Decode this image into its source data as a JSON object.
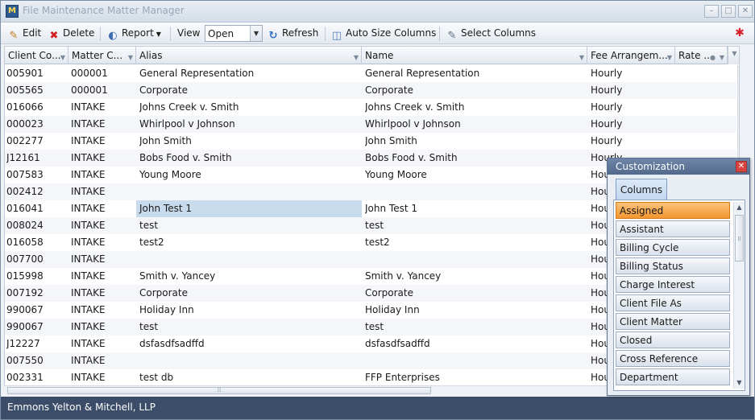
{
  "window": {
    "title": "File Maintenance Matter Manager",
    "minimize_icon": "minimize-icon",
    "maximize_icon": "maximize-icon",
    "close_icon": "close-icon"
  },
  "toolbar": {
    "edit_label": "Edit",
    "delete_label": "Delete",
    "report_label": "Report",
    "view_label": "View",
    "view_value": "Open",
    "refresh_label": "Refresh",
    "autosize_label": "Auto Size Columns",
    "select_columns_label": "Select Columns"
  },
  "grid": {
    "columns": [
      {
        "label": "Client Co..."
      },
      {
        "label": "Matter C..."
      },
      {
        "label": "Alias"
      },
      {
        "label": "Name"
      },
      {
        "label": "Fee Arrangem..."
      },
      {
        "label": "Rate ..."
      }
    ],
    "rows": [
      [
        "005901",
        "000001",
        "General Representation",
        "General Representation",
        "Hourly"
      ],
      [
        "005565",
        "000001",
        "Corporate",
        "Corporate",
        "Hourly"
      ],
      [
        "016066",
        "INTAKE",
        "Johns Creek v. Smith",
        "Johns Creek v. Smith",
        "Hourly"
      ],
      [
        "000023",
        "INTAKE",
        "Whirlpool v Johnson",
        "Whirlpool v Johnson",
        "Hourly"
      ],
      [
        "002277",
        "INTAKE",
        "John Smith",
        "John Smith",
        "Hourly"
      ],
      [
        "J12161",
        "INTAKE",
        "Bobs Food v. Smith",
        "Bobs Food v. Smith",
        "Hourly"
      ],
      [
        "007583",
        "INTAKE",
        "Young Moore",
        "Young Moore",
        "Hou"
      ],
      [
        "002412",
        "INTAKE",
        "",
        "",
        "Hou"
      ],
      [
        "016041",
        "INTAKE",
        "John Test 1",
        "John Test 1",
        "Hou"
      ],
      [
        "008024",
        "INTAKE",
        "test",
        "test",
        "Hou"
      ],
      [
        "016058",
        "INTAKE",
        "test2",
        "test2",
        "Hou"
      ],
      [
        "007700",
        "INTAKE",
        "",
        "",
        "Hou"
      ],
      [
        "015998",
        "INTAKE",
        "Smith v. Yancey",
        "Smith v. Yancey",
        "Hou"
      ],
      [
        "007192",
        "INTAKE",
        "Corporate",
        "Corporate",
        "Hou"
      ],
      [
        "990067",
        "INTAKE",
        "Holiday Inn",
        "Holiday Inn",
        "Hou"
      ],
      [
        "990067",
        "INTAKE",
        "test",
        "test",
        "Hou"
      ],
      [
        "J12227",
        "INTAKE",
        "dsfasdfsadffd",
        "dsfasdfsadffd",
        "Hou"
      ],
      [
        "007550",
        "INTAKE",
        "",
        "",
        "Hou"
      ],
      [
        "002331",
        "INTAKE",
        "test db",
        "FFP Enterprises",
        "Hou"
      ]
    ]
  },
  "customization": {
    "title": "Customization",
    "tab_label": "Columns",
    "items": [
      "Assigned",
      "Assistant",
      "Billing Cycle",
      "Billing Status",
      "Charge Interest",
      "Client File As",
      "Client Matter",
      "Closed",
      "Cross Reference",
      "Department"
    ]
  },
  "status": {
    "firm": "Emmons Yelton & Mitchell, LLP"
  }
}
